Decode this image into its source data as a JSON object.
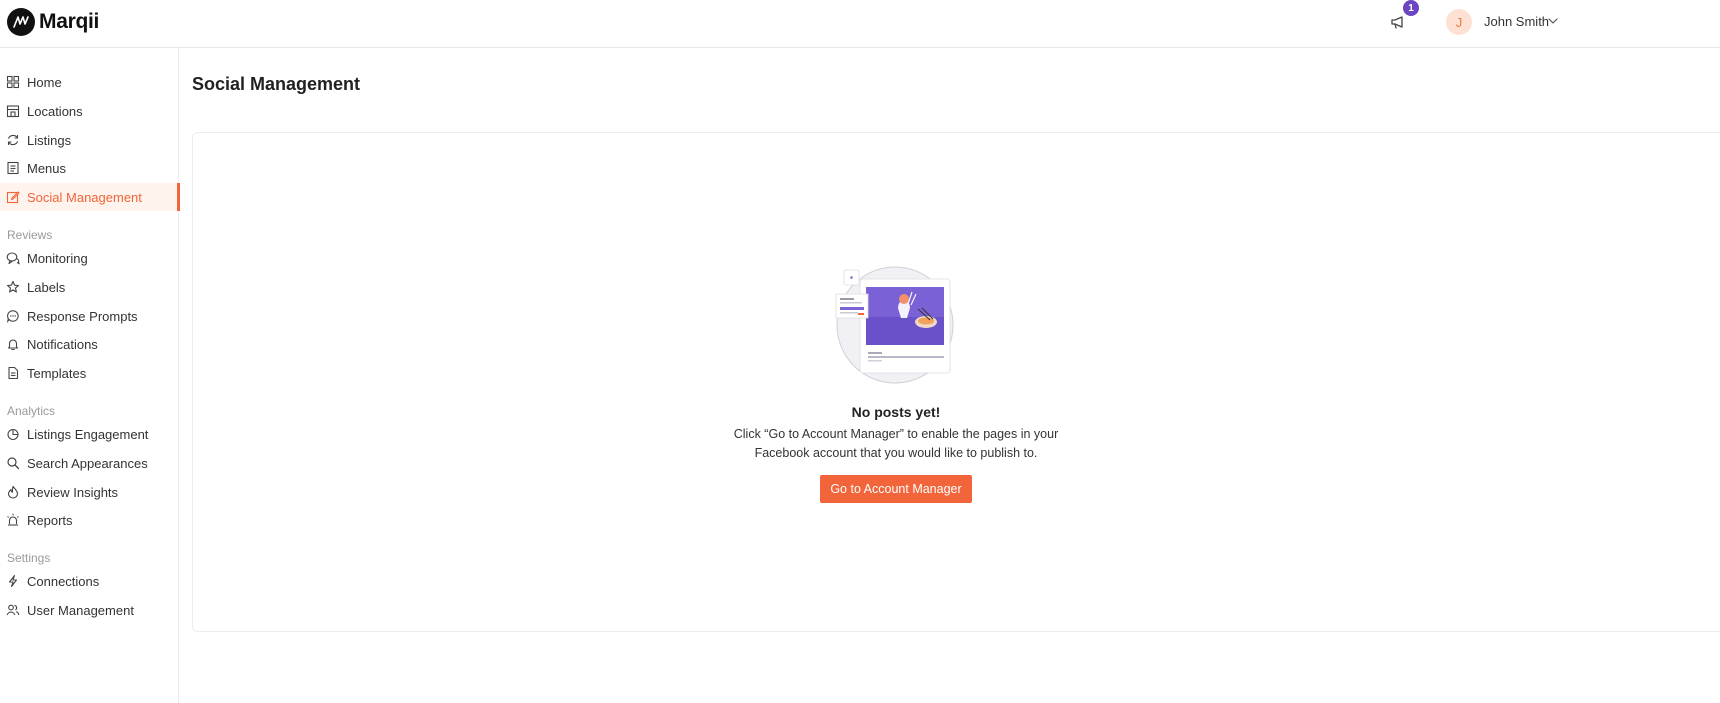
{
  "header": {
    "brand": "Marqii",
    "notification_count": "1",
    "user_initial": "J",
    "user_name": "John Smith"
  },
  "sidebar": {
    "main_items": [
      {
        "label": "Home",
        "icon": "grid-icon"
      },
      {
        "label": "Locations",
        "icon": "store-icon"
      },
      {
        "label": "Listings",
        "icon": "refresh-icon"
      },
      {
        "label": "Menus",
        "icon": "menu-book-icon"
      },
      {
        "label": "Social Management",
        "icon": "edit-icon",
        "active": true
      }
    ],
    "reviews_title": "Reviews",
    "reviews_items": [
      {
        "label": "Monitoring",
        "icon": "chat-icon"
      },
      {
        "label": "Labels",
        "icon": "star-icon"
      },
      {
        "label": "Response Prompts",
        "icon": "message-dots-icon"
      },
      {
        "label": "Notifications",
        "icon": "bell-icon"
      },
      {
        "label": "Templates",
        "icon": "document-icon"
      }
    ],
    "analytics_title": "Analytics",
    "analytics_items": [
      {
        "label": "Listings Engagement",
        "icon": "pie-chart-icon"
      },
      {
        "label": "Search Appearances",
        "icon": "search-icon"
      },
      {
        "label": "Review Insights",
        "icon": "flame-icon"
      },
      {
        "label": "Reports",
        "icon": "siren-icon"
      }
    ],
    "settings_title": "Settings",
    "settings_items": [
      {
        "label": "Connections",
        "icon": "bolt-icon"
      },
      {
        "label": "User Management",
        "icon": "users-icon"
      }
    ]
  },
  "main": {
    "title": "Social Management",
    "empty_state": {
      "title": "No posts yet!",
      "description": "Click “Go to Account Manager” to enable the pages in your Facebook account that you would like to publish to.",
      "button_label": "Go to Account Manager"
    }
  },
  "colors": {
    "accent": "#f2643a",
    "badge": "#6b46c1"
  }
}
